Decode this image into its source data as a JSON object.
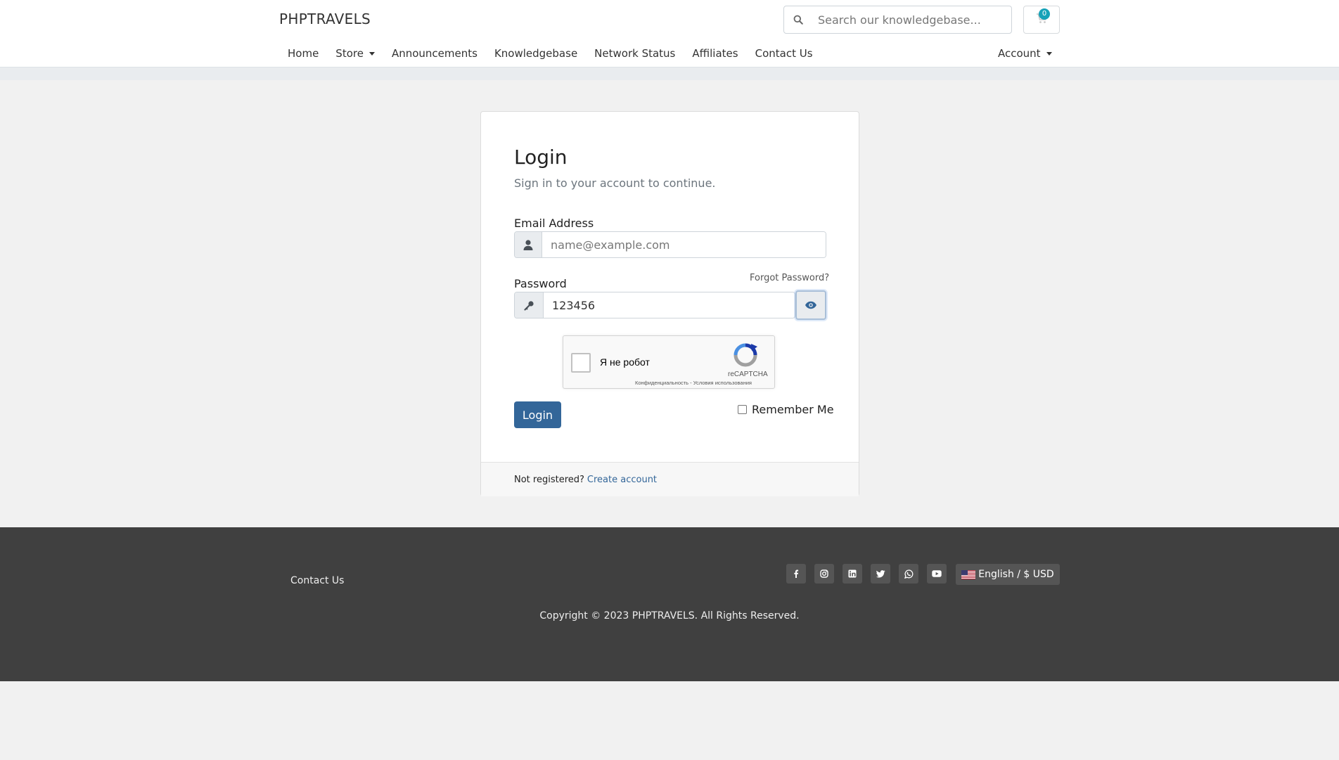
{
  "header": {
    "brand": "PHPTRAVELS",
    "search_placeholder": "Search our knowledgebase...",
    "cart_count": "0",
    "nav": [
      {
        "label": "Home"
      },
      {
        "label": "Store"
      },
      {
        "label": "Announcements"
      },
      {
        "label": "Knowledgebase"
      },
      {
        "label": "Network Status"
      },
      {
        "label": "Affiliates"
      },
      {
        "label": "Contact Us"
      }
    ],
    "account_label": "Account"
  },
  "login": {
    "title": "Login",
    "subtitle": "Sign in to your account to continue.",
    "email_label": "Email Address",
    "email_placeholder": "name@example.com",
    "password_label": "Password",
    "forgot_label": "Forgot Password?",
    "password_value": "123456",
    "recaptcha": {
      "text": "Я не робот",
      "brand": "reCAPTCHA",
      "terms": "Конфиденциальность - Условия использования"
    },
    "login_button": "Login",
    "remember_label": "Remember Me",
    "not_registered": "Not registered?",
    "create_account": "Create account"
  },
  "footer": {
    "contact_label": "Contact Us",
    "social_icons": [
      "facebook-icon",
      "instagram-icon",
      "linkedin-icon",
      "twitter-icon",
      "whatsapp-icon",
      "youtube-icon"
    ],
    "language_label": "English / $ USD",
    "copyright": "Copyright © 2023 PHPTRAVELS. All Rights Reserved."
  },
  "colors": {
    "primary": "#336699",
    "badge": "#17a2b8",
    "footer_bg": "#404040",
    "page_bg": "#f1f1f1"
  }
}
